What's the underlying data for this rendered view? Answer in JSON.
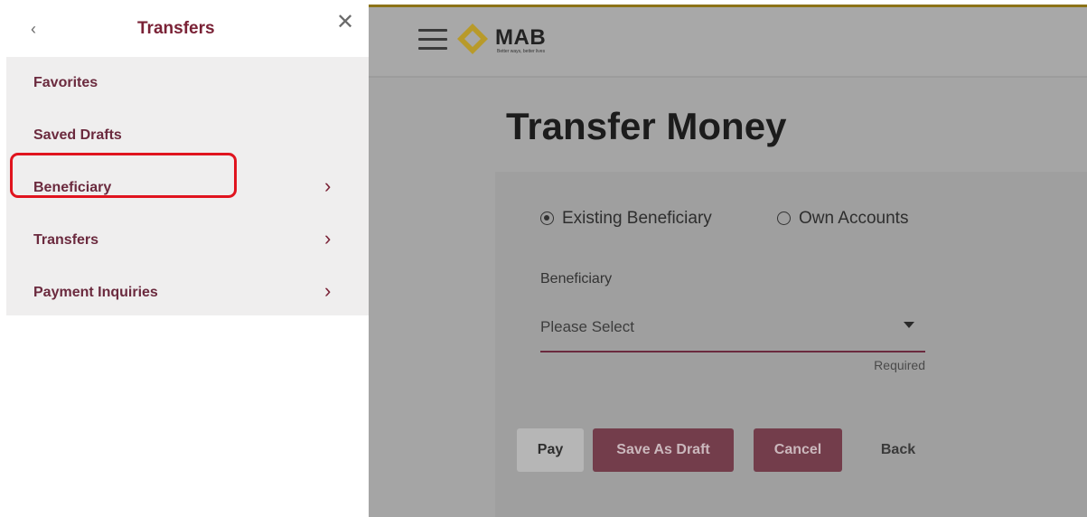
{
  "sidebar": {
    "back_glyph": "‹",
    "title": "Transfers",
    "close_glyph": "✕",
    "items": [
      {
        "label": "Favorites",
        "has_submenu": false
      },
      {
        "label": "Saved Drafts",
        "has_submenu": false
      },
      {
        "label": "Beneficiary",
        "has_submenu": true
      },
      {
        "label": "Transfers",
        "has_submenu": true
      },
      {
        "label": "Payment Inquiries",
        "has_submenu": true
      }
    ],
    "chevron_glyph": "›",
    "highlighted_item": "Beneficiary"
  },
  "header": {
    "logo_text": "MAB",
    "logo_tagline": "Better ways, better lives",
    "brand_color": "#7a2236",
    "accent_color": "#8c7317"
  },
  "main": {
    "title": "Transfer Money",
    "radio_options": [
      {
        "label": "Existing Beneficiary",
        "selected": true
      },
      {
        "label": "Own Accounts",
        "selected": false
      }
    ],
    "beneficiary_label": "Beneficiary",
    "beneficiary_value": "Please Select",
    "beneficiary_hint": "Required",
    "buttons": {
      "pay": "Pay",
      "save_draft": "Save As Draft",
      "cancel": "Cancel",
      "back": "Back"
    }
  }
}
